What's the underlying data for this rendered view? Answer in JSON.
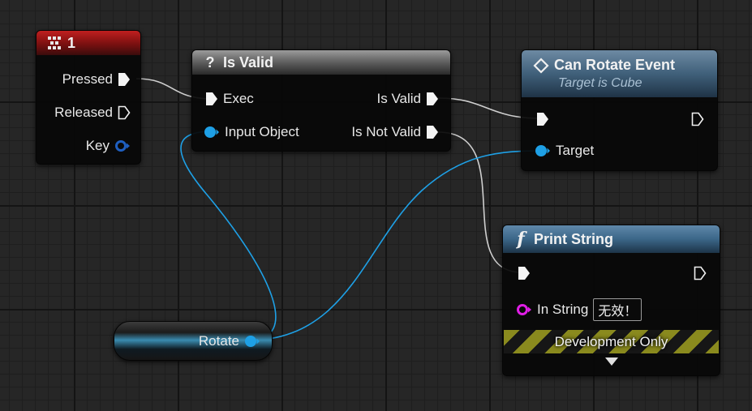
{
  "colors": {
    "exec_wire": "#d0d0d0",
    "object_wire": "#1ea0e6",
    "object_pin": "#1ea0e6",
    "string_pin": "#e01ee6",
    "key_pin": "#1f5fc0",
    "event_header": "#b02020",
    "function_header": "#3d6f96"
  },
  "input_event": {
    "icon": "keyboard-icon",
    "title": "1",
    "pins": {
      "pressed": "Pressed",
      "released": "Released",
      "key": "Key"
    }
  },
  "is_valid": {
    "icon": "question-icon",
    "title": "Is Valid",
    "pins": {
      "exec": "Exec",
      "input_object": "Input Object",
      "is_valid": "Is Valid",
      "is_not_valid": "Is Not Valid"
    }
  },
  "can_rotate": {
    "icon": "event-diamond-icon",
    "title": "Can Rotate Event",
    "subtitle": "Target is Cube",
    "pins": {
      "target": "Target"
    }
  },
  "print_string": {
    "icon": "function-icon",
    "title": "Print String",
    "pins": {
      "in_string": "In String",
      "in_string_value": "无效！"
    },
    "dev_label": "Development Only",
    "expand_icon": "expand-arrow-icon"
  },
  "rotate_var": {
    "label": "Rotate"
  }
}
